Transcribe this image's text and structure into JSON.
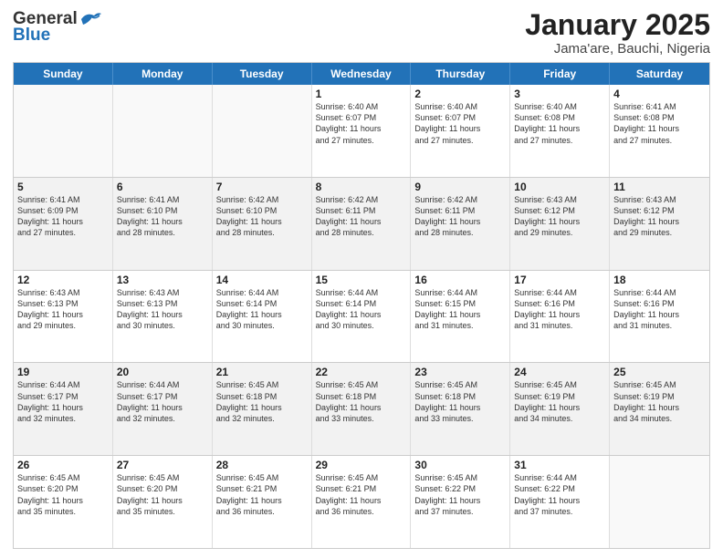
{
  "header": {
    "logo_general": "General",
    "logo_blue": "Blue",
    "title": "January 2025",
    "subtitle": "Jama'are, Bauchi, Nigeria"
  },
  "days_of_week": [
    "Sunday",
    "Monday",
    "Tuesday",
    "Wednesday",
    "Thursday",
    "Friday",
    "Saturday"
  ],
  "weeks": [
    [
      {
        "day": "",
        "text": "",
        "empty": true
      },
      {
        "day": "",
        "text": "",
        "empty": true
      },
      {
        "day": "",
        "text": "",
        "empty": true
      },
      {
        "day": "1",
        "text": "Sunrise: 6:40 AM\nSunset: 6:07 PM\nDaylight: 11 hours\nand 27 minutes.",
        "empty": false
      },
      {
        "day": "2",
        "text": "Sunrise: 6:40 AM\nSunset: 6:07 PM\nDaylight: 11 hours\nand 27 minutes.",
        "empty": false
      },
      {
        "day": "3",
        "text": "Sunrise: 6:40 AM\nSunset: 6:08 PM\nDaylight: 11 hours\nand 27 minutes.",
        "empty": false
      },
      {
        "day": "4",
        "text": "Sunrise: 6:41 AM\nSunset: 6:08 PM\nDaylight: 11 hours\nand 27 minutes.",
        "empty": false
      }
    ],
    [
      {
        "day": "5",
        "text": "Sunrise: 6:41 AM\nSunset: 6:09 PM\nDaylight: 11 hours\nand 27 minutes.",
        "empty": false
      },
      {
        "day": "6",
        "text": "Sunrise: 6:41 AM\nSunset: 6:10 PM\nDaylight: 11 hours\nand 28 minutes.",
        "empty": false
      },
      {
        "day": "7",
        "text": "Sunrise: 6:42 AM\nSunset: 6:10 PM\nDaylight: 11 hours\nand 28 minutes.",
        "empty": false
      },
      {
        "day": "8",
        "text": "Sunrise: 6:42 AM\nSunset: 6:11 PM\nDaylight: 11 hours\nand 28 minutes.",
        "empty": false
      },
      {
        "day": "9",
        "text": "Sunrise: 6:42 AM\nSunset: 6:11 PM\nDaylight: 11 hours\nand 28 minutes.",
        "empty": false
      },
      {
        "day": "10",
        "text": "Sunrise: 6:43 AM\nSunset: 6:12 PM\nDaylight: 11 hours\nand 29 minutes.",
        "empty": false
      },
      {
        "day": "11",
        "text": "Sunrise: 6:43 AM\nSunset: 6:12 PM\nDaylight: 11 hours\nand 29 minutes.",
        "empty": false
      }
    ],
    [
      {
        "day": "12",
        "text": "Sunrise: 6:43 AM\nSunset: 6:13 PM\nDaylight: 11 hours\nand 29 minutes.",
        "empty": false
      },
      {
        "day": "13",
        "text": "Sunrise: 6:43 AM\nSunset: 6:13 PM\nDaylight: 11 hours\nand 30 minutes.",
        "empty": false
      },
      {
        "day": "14",
        "text": "Sunrise: 6:44 AM\nSunset: 6:14 PM\nDaylight: 11 hours\nand 30 minutes.",
        "empty": false
      },
      {
        "day": "15",
        "text": "Sunrise: 6:44 AM\nSunset: 6:14 PM\nDaylight: 11 hours\nand 30 minutes.",
        "empty": false
      },
      {
        "day": "16",
        "text": "Sunrise: 6:44 AM\nSunset: 6:15 PM\nDaylight: 11 hours\nand 31 minutes.",
        "empty": false
      },
      {
        "day": "17",
        "text": "Sunrise: 6:44 AM\nSunset: 6:16 PM\nDaylight: 11 hours\nand 31 minutes.",
        "empty": false
      },
      {
        "day": "18",
        "text": "Sunrise: 6:44 AM\nSunset: 6:16 PM\nDaylight: 11 hours\nand 31 minutes.",
        "empty": false
      }
    ],
    [
      {
        "day": "19",
        "text": "Sunrise: 6:44 AM\nSunset: 6:17 PM\nDaylight: 11 hours\nand 32 minutes.",
        "empty": false
      },
      {
        "day": "20",
        "text": "Sunrise: 6:44 AM\nSunset: 6:17 PM\nDaylight: 11 hours\nand 32 minutes.",
        "empty": false
      },
      {
        "day": "21",
        "text": "Sunrise: 6:45 AM\nSunset: 6:18 PM\nDaylight: 11 hours\nand 32 minutes.",
        "empty": false
      },
      {
        "day": "22",
        "text": "Sunrise: 6:45 AM\nSunset: 6:18 PM\nDaylight: 11 hours\nand 33 minutes.",
        "empty": false
      },
      {
        "day": "23",
        "text": "Sunrise: 6:45 AM\nSunset: 6:18 PM\nDaylight: 11 hours\nand 33 minutes.",
        "empty": false
      },
      {
        "day": "24",
        "text": "Sunrise: 6:45 AM\nSunset: 6:19 PM\nDaylight: 11 hours\nand 34 minutes.",
        "empty": false
      },
      {
        "day": "25",
        "text": "Sunrise: 6:45 AM\nSunset: 6:19 PM\nDaylight: 11 hours\nand 34 minutes.",
        "empty": false
      }
    ],
    [
      {
        "day": "26",
        "text": "Sunrise: 6:45 AM\nSunset: 6:20 PM\nDaylight: 11 hours\nand 35 minutes.",
        "empty": false
      },
      {
        "day": "27",
        "text": "Sunrise: 6:45 AM\nSunset: 6:20 PM\nDaylight: 11 hours\nand 35 minutes.",
        "empty": false
      },
      {
        "day": "28",
        "text": "Sunrise: 6:45 AM\nSunset: 6:21 PM\nDaylight: 11 hours\nand 36 minutes.",
        "empty": false
      },
      {
        "day": "29",
        "text": "Sunrise: 6:45 AM\nSunset: 6:21 PM\nDaylight: 11 hours\nand 36 minutes.",
        "empty": false
      },
      {
        "day": "30",
        "text": "Sunrise: 6:45 AM\nSunset: 6:22 PM\nDaylight: 11 hours\nand 37 minutes.",
        "empty": false
      },
      {
        "day": "31",
        "text": "Sunrise: 6:44 AM\nSunset: 6:22 PM\nDaylight: 11 hours\nand 37 minutes.",
        "empty": false
      },
      {
        "day": "",
        "text": "",
        "empty": true
      }
    ]
  ]
}
